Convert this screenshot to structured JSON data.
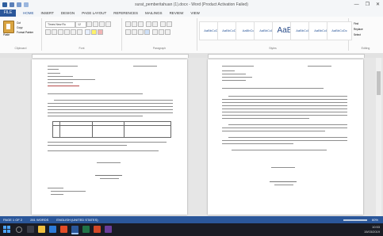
{
  "window": {
    "title": "surat_pemberitahuan (1).docx - Word (Product Activation Failed)",
    "controls": [
      "—",
      "❐",
      "✕"
    ]
  },
  "ribbon": {
    "file_tab": "FILE",
    "tabs": [
      "HOME",
      "INSERT",
      "DESIGN",
      "PAGE LAYOUT",
      "REFERENCES",
      "MAILINGS",
      "REVIEW",
      "VIEW"
    ],
    "active_tab": "HOME",
    "groups": [
      "Clipboard",
      "Font",
      "Paragraph",
      "Styles",
      "Editing"
    ],
    "paste_label": "Paste",
    "clipboard_items": [
      "Cut",
      "Copy",
      "Format Painter"
    ],
    "font_name": "Times New Ro",
    "font_size": "12",
    "styles": [
      "AaBbCcDc",
      "AaBbCcDc",
      "AaBbCc",
      "AaBbCcD",
      "AaB",
      "AaBbCcD",
      "AaBbCcD",
      "AaBbCcDc"
    ],
    "editing_items": [
      "Find",
      "Replace",
      "Select"
    ]
  },
  "status": {
    "page": "PAGE 1 OF 2",
    "words": "281 WORDS",
    "language": "ENGLISH (UNITED STATES)",
    "zoom": "60%"
  },
  "taskbar": {
    "time": "10:53",
    "date": "15/03/2019"
  }
}
